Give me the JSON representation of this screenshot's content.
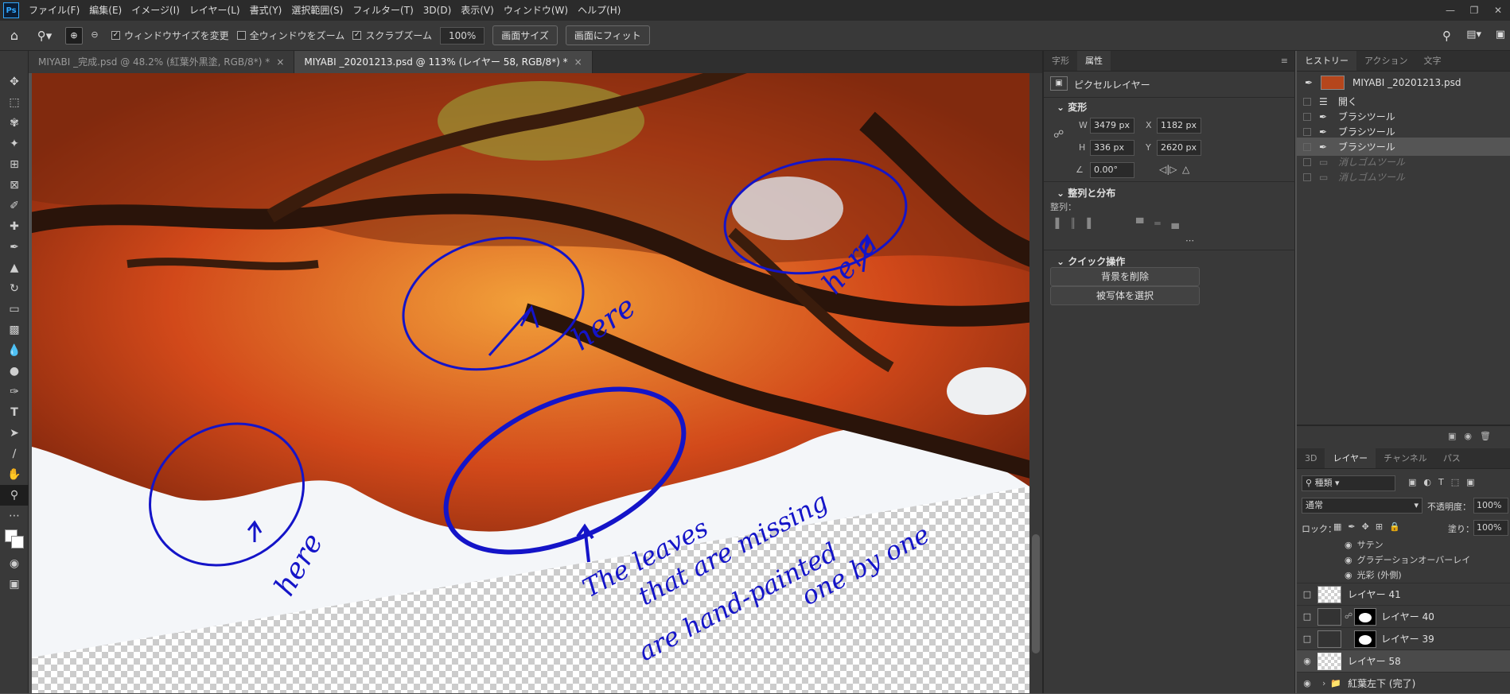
{
  "app": {
    "logo": "Ps"
  },
  "menu": [
    "ファイル(F)",
    "編集(E)",
    "イメージ(I)",
    "レイヤー(L)",
    "書式(Y)",
    "選択範囲(S)",
    "フィルター(T)",
    "3D(D)",
    "表示(V)",
    "ウィンドウ(W)",
    "ヘルプ(H)"
  ],
  "options": {
    "resize_windows": "ウィンドウサイズを変更",
    "zoom_all": "全ウィンドウをズーム",
    "scrubby_zoom": "スクラブズーム",
    "zoom_value": "100%",
    "screen_size": "画面サイズ",
    "fit_screen": "画面にフィット"
  },
  "tabs": [
    {
      "label": "MIYABI _完成.psd @ 48.2% (紅葉外黒塗, RGB/8*) *",
      "active": false
    },
    {
      "label": "MIYABI _20201213.psd @ 113% (レイヤー 58, RGB/8*) *",
      "active": true
    }
  ],
  "annotations": {
    "here": "here",
    "note_lines": [
      "The leaves",
      "that are missing",
      "are hand-painted",
      "one by one"
    ]
  },
  "properties": {
    "tabs": [
      "字形",
      "属性"
    ],
    "layer_type": "ピクセルレイヤー",
    "transform_title": "変形",
    "w_label": "W",
    "w": "3479 px",
    "x_label": "X",
    "x": "1182 px",
    "h_label": "H",
    "h": "336 px",
    "y_label": "Y",
    "y": "2620 px",
    "angle": "0.00°",
    "align_title": "整列と分布",
    "align_label": "整列：",
    "quick_title": "クイック操作",
    "remove_bg": "背景を削除",
    "select_subject": "被写体を選択"
  },
  "history": {
    "tabs": [
      "ヒストリー",
      "アクション",
      "文字"
    ],
    "snapshot": "MIYABI _20201213.psd",
    "items": [
      {
        "label": "開く",
        "icon": "document-icon",
        "state": "normal"
      },
      {
        "label": "ブラシツール",
        "icon": "brush-icon",
        "state": "normal"
      },
      {
        "label": "ブラシツール",
        "icon": "brush-icon",
        "state": "normal"
      },
      {
        "label": "ブラシツール",
        "icon": "brush-icon",
        "state": "selected"
      },
      {
        "label": "消しゴムツール",
        "icon": "eraser-icon",
        "state": "dimmed"
      },
      {
        "label": "消しゴムツール",
        "icon": "eraser-icon",
        "state": "dimmed"
      }
    ]
  },
  "layers": {
    "tabs": [
      "3D",
      "レイヤー",
      "チャンネル",
      "パス"
    ],
    "filter": "種類",
    "blend": "通常",
    "opacity_label": "不透明度：",
    "opacity": "100%",
    "lock_label": "ロック：",
    "fill_label": "塗り：",
    "fill": "100%",
    "effects": [
      "サテン",
      "グラデーションオーバーレイ",
      "光彩 (外側)"
    ],
    "rows": [
      {
        "name": "レイヤー 41",
        "visible": false,
        "mask": false
      },
      {
        "name": "レイヤー 40",
        "visible": false,
        "mask": true
      },
      {
        "name": "レイヤー 39",
        "visible": false,
        "mask": true
      },
      {
        "name": "レイヤー 58",
        "visible": true,
        "mask": false
      },
      {
        "name": "紅葉左下 (完了)",
        "visible": true,
        "group": true
      }
    ]
  }
}
